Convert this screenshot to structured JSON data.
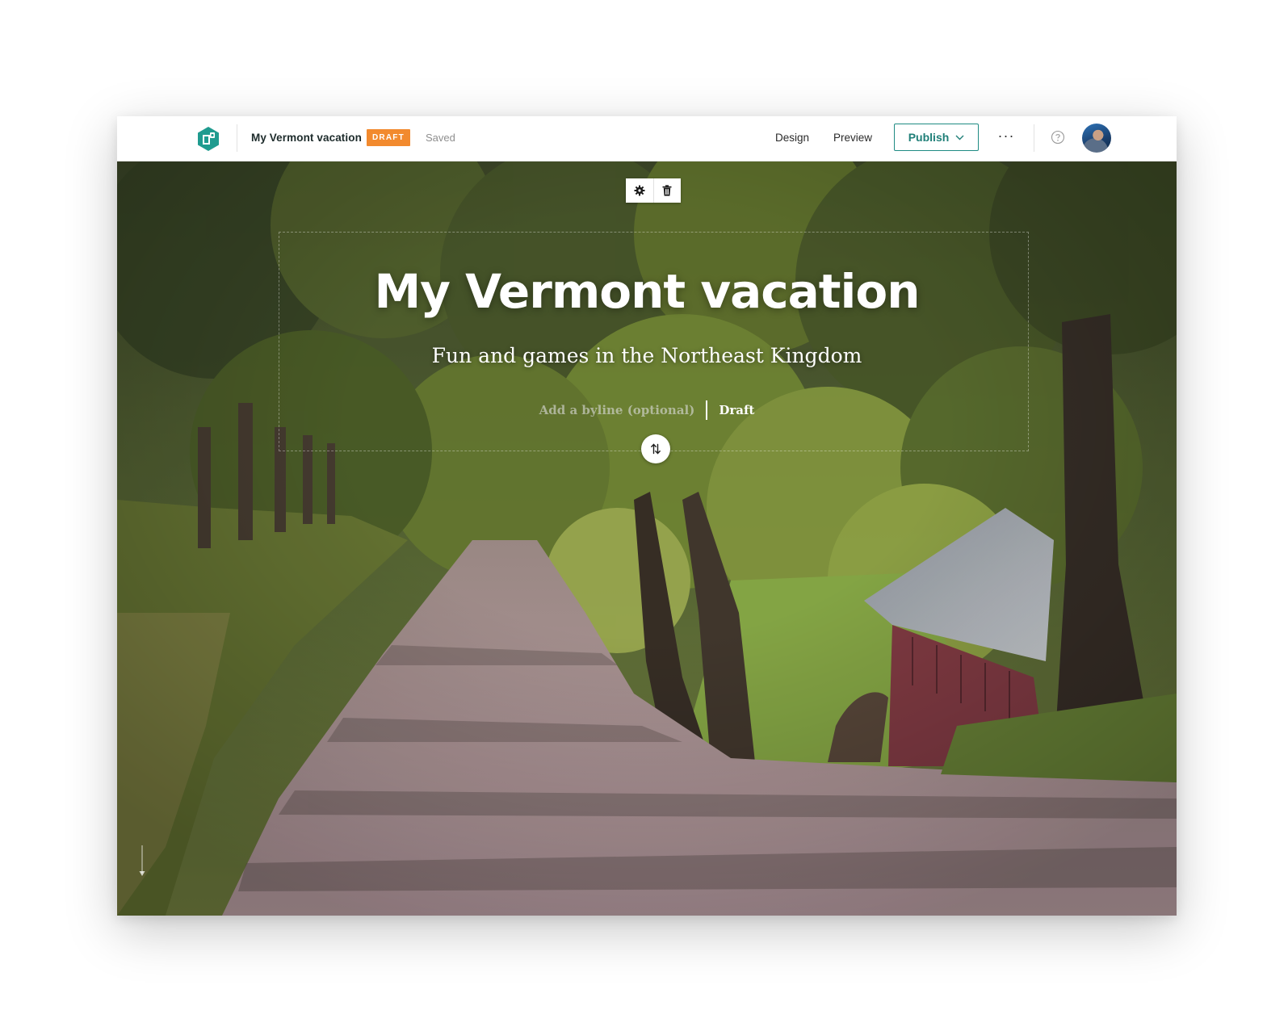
{
  "app": {
    "name": "ArcGIS StoryMaps",
    "accent": "#1f8b83",
    "logo_icon": "storymaps-logo-icon"
  },
  "header": {
    "doc_title": "My Vermont vacation",
    "status_badge": "DRAFT",
    "status_badge_color": "#f28a2e",
    "save_state": "Saved",
    "nav": {
      "design": "Design",
      "preview": "Preview"
    },
    "publish_label": "Publish",
    "more_icon": "ellipsis-icon",
    "help_icon": "help-circle-icon",
    "avatar_icon": "user-avatar"
  },
  "block_toolbar": {
    "settings_icon": "gear-icon",
    "delete_icon": "trash-icon"
  },
  "hero": {
    "title": "My Vermont vacation",
    "subtitle": "Fun and games in the Northeast Kingdom",
    "byline_placeholder": "Add a byline (optional)",
    "status": "Draft",
    "swap_icon": "swap-vertical-icon",
    "scroll_icon": "scroll-down-arrow-icon"
  }
}
